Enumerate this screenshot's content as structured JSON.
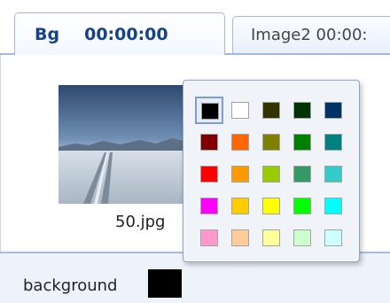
{
  "tabs": [
    {
      "name": "Bg",
      "time": "00:00:00",
      "active": true
    },
    {
      "label": "Image2 00:00:",
      "active": false
    }
  ],
  "image": {
    "filename": "50.jpg"
  },
  "background": {
    "label": "background",
    "color": "#000000"
  },
  "palette": {
    "selected_index": 0,
    "colors": [
      "#000000",
      "#ffffff",
      "#333300",
      "#003300",
      "#003366",
      "#800000",
      "#ff6600",
      "#808000",
      "#008000",
      "#008080",
      "#ff0000",
      "#ff9900",
      "#99cc00",
      "#339966",
      "#33cccc",
      "#ff00ff",
      "#ffcc00",
      "#ffff00",
      "#00ff00",
      "#00ffff",
      "#ff99cc",
      "#ffcc99",
      "#ffff99",
      "#ccffcc",
      "#ccffff"
    ]
  }
}
